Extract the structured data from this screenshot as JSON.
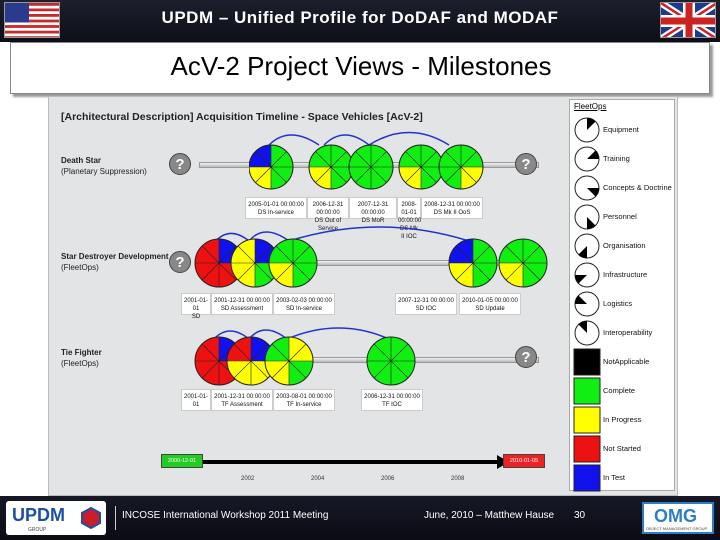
{
  "header": {
    "title": "UPDM – Unified Profile for DoDAF and MODAF",
    "flag_left": "us-flag-icon",
    "flag_right": "uk-flag-icon"
  },
  "slide": {
    "title": "AcV-2 Project Views - Milestones"
  },
  "diagram": {
    "title": "[Architectural Description] Acquisition Timeline - Space Vehicles [AcV-2]",
    "rows": [
      {
        "name": "Death Star",
        "sub": "(Planetary Suppression)",
        "milestones": [
          {
            "date": "2005-01-01 00:00:00",
            "name": "DS In-service"
          },
          {
            "date": "2006-12-31 00:00:00",
            "name": "DS Out of Service"
          },
          {
            "date": "2007-12-31 00:00:00",
            "name": "DS MoR"
          },
          {
            "date": "2008-01-01 00:00:00",
            "name": "DS Mk II IOC"
          },
          {
            "date": "2008-12-31 00:00:00",
            "name": "DS Mk II OoS"
          }
        ]
      },
      {
        "name": "Star Destroyer Development",
        "sub": "(FleetOps)",
        "milestones": [
          {
            "date": "2001-01-01",
            "name": "SD"
          },
          {
            "date": "2001-12-31 00:00:00",
            "name": "SD Assessment"
          },
          {
            "date": "2003-02-03 00:00:00",
            "name": "SD In-service"
          },
          {
            "date": "2007-12-31 00:00:00",
            "name": "SD IOC"
          },
          {
            "date": "2010-01-05 00:00:00",
            "name": "SD Update"
          }
        ]
      },
      {
        "name": "Tie Fighter",
        "sub": "(FleetOps)",
        "milestones": [
          {
            "date": "2001-01-01",
            "name": ""
          },
          {
            "date": "2001-12-31 00:00:00",
            "name": "TF Assessment"
          },
          {
            "date": "2003-08-01 00:00:00",
            "name": "TF In-service"
          },
          {
            "date": "2006-12-31 00:00:00",
            "name": "TF IOC"
          }
        ]
      }
    ],
    "timeline": {
      "start_label": "2000-12-01",
      "end_label": "2010-01-05",
      "ticks": [
        "2002",
        "2004",
        "2006",
        "2008"
      ]
    }
  },
  "legend": {
    "title": "FleetOps",
    "items": [
      {
        "label": "Equipment",
        "icon": "equipment-segment-icon"
      },
      {
        "label": "Training",
        "icon": "training-segment-icon"
      },
      {
        "label": "Concepts & Doctrine",
        "icon": "concepts-doctrine-segment-icon"
      },
      {
        "label": "Personnel",
        "icon": "personnel-segment-icon"
      },
      {
        "label": "Organisation",
        "icon": "organisation-segment-icon"
      },
      {
        "label": "Infrastructure",
        "icon": "infrastructure-segment-icon"
      },
      {
        "label": "Logistics",
        "icon": "logistics-segment-icon"
      },
      {
        "label": "Interoperability",
        "icon": "interoperability-segment-icon"
      },
      {
        "label": "NotApplicable",
        "color": "#000000"
      },
      {
        "label": "Complete",
        "color": "#11ee11"
      },
      {
        "label": "In Progress",
        "color": "#ffff00"
      },
      {
        "label": "Not Started",
        "color": "#ee1111"
      },
      {
        "label": "In Test",
        "color": "#1111ee"
      }
    ]
  },
  "footer": {
    "left_text": "INCOSE International Workshop 2011 Meeting",
    "right_text": "June, 2010 – Matthew Hause",
    "page": "30",
    "logo_left": "UPDM",
    "logo_left_sub": "GROUP",
    "logo_right": "OMG",
    "logo_right_sub": "OBJECT MANAGEMENT GROUP"
  },
  "colors": {
    "complete": "#11ee11",
    "in_progress": "#ffff00",
    "not_started": "#ee1111",
    "in_test": "#1111ee",
    "not_applicable": "#000000"
  }
}
